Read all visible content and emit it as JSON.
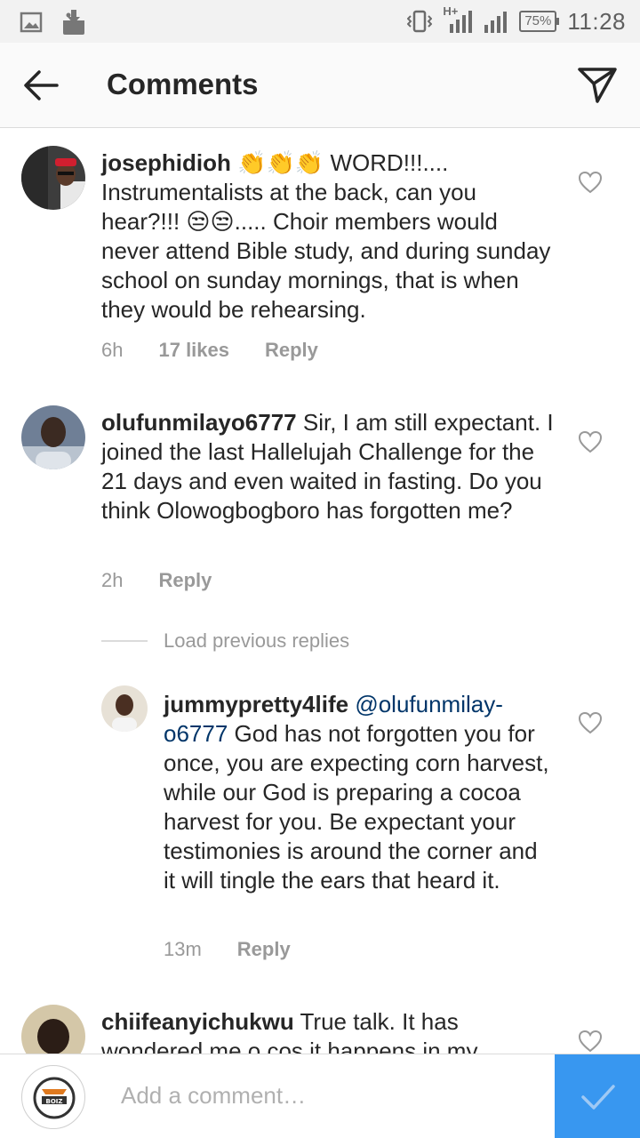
{
  "status_bar": {
    "battery": "75%",
    "time": "11:28",
    "network": "H+"
  },
  "header": {
    "title": "Comments"
  },
  "comments": [
    {
      "username": "josephidioh",
      "text_parts": [
        " ",
        "👏👏👏",
        " WORD!!!.... Instrumentalists at the back, can you hear?!!! ",
        "😒😒",
        "..... Choir members would never attend Bible study, and during sunday school on sunday mornings, that is when they would be rehearsing."
      ],
      "time": "6h",
      "likes": "17 likes",
      "reply": "Reply"
    },
    {
      "username": "olufunmilayo6777",
      "text": " Sir, I am still expectant. I joined the last Hallelujah Challenge for the 21 days and even waited in fasting. Do you think Olowogbogboro has forgotten me?",
      "time": "2h",
      "reply": "Reply"
    },
    {
      "username": "chiifeanyichukwu",
      "text": " True talk. It has wondered me o cos it happens in my"
    }
  ],
  "load_previous": "Load previous replies",
  "reply_comment": {
    "username": "jummypretty4life",
    "mention": "@olufunmilay-o6777",
    "text": "  God has not forgotten you for once, you are expecting corn harvest, while our God is preparing a cocoa harvest for you. Be expectant your testimonies is around the corner and it will tingle the ears that heard it.",
    "time": "13m",
    "reply": "Reply"
  },
  "comment_bar": {
    "placeholder": "Add a comment…",
    "avatar_logo_text": "BOIZ"
  }
}
